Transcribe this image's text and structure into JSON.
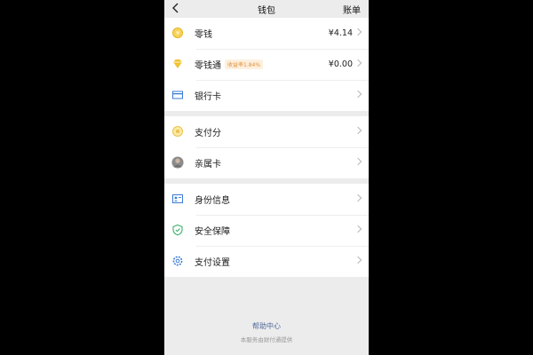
{
  "header": {
    "title": "钱包",
    "right_action": "账单"
  },
  "groups": [
    {
      "items": [
        {
          "label": "零钱",
          "value": "¥4.14",
          "icon": "coin-icon"
        },
        {
          "label": "零钱通",
          "badge": "收益率1.84%",
          "value": "¥0.00",
          "icon": "diamond-icon"
        },
        {
          "label": "银行卡",
          "icon": "bank-card-icon"
        }
      ]
    },
    {
      "items": [
        {
          "label": "支付分",
          "icon": "pay-score-icon"
        },
        {
          "label": "亲属卡",
          "icon": "family-card-avatar"
        }
      ]
    },
    {
      "items": [
        {
          "label": "身份信息",
          "icon": "id-card-icon"
        },
        {
          "label": "安全保障",
          "icon": "shield-icon"
        },
        {
          "label": "支付设置",
          "icon": "gear-icon"
        }
      ]
    }
  ],
  "footer": {
    "help": "帮助中心",
    "note": "本服务由财付通提供"
  },
  "colors": {
    "accent_yellow": "#f0c12c",
    "accent_blue": "#3a7bd5",
    "accent_green": "#3bb06a",
    "link": "#4f6b9a"
  }
}
